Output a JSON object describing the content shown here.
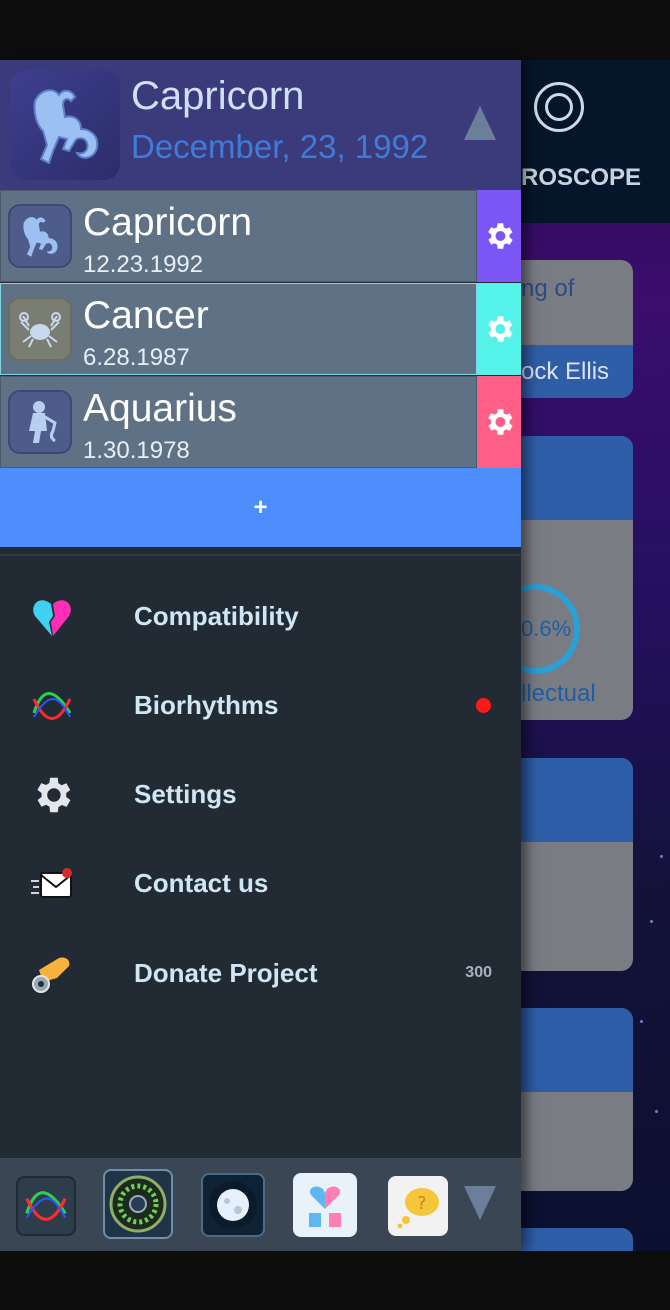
{
  "background_app": {
    "header_title_fragment": "ROSCOPE",
    "card1_text_a": "ng of",
    "card1_text_b": "ock Ellis",
    "gauge_value": "0.6%",
    "gauge_label": "llectual"
  },
  "drawer": {
    "current_profile": {
      "name": "Capricorn",
      "date": "December, 23, 1992",
      "icon": "capricorn-icon"
    },
    "profiles": [
      {
        "name": "Capricorn",
        "date": "12.23.1992",
        "icon": "capricorn-icon",
        "color": "#7c56f5"
      },
      {
        "name": "Cancer",
        "date": "6.28.1987",
        "icon": "cancer-icon",
        "color": "#54f2e8"
      },
      {
        "name": "Aquarius",
        "date": "1.30.1978",
        "icon": "aquarius-icon",
        "color": "#ff5f86"
      }
    ],
    "add_button_label": "+",
    "menu": [
      {
        "label": "Compatibility",
        "icon": "heart-icon"
      },
      {
        "label": "Biorhythms",
        "icon": "biorhythm-icon",
        "has_notification": true
      },
      {
        "label": "Settings",
        "icon": "gear-icon"
      },
      {
        "label": "Contact us",
        "icon": "mail-icon"
      },
      {
        "label": "Donate Project",
        "icon": "donate-icon",
        "count": "300"
      }
    ],
    "bottom_apps": [
      "biorhythm-app-icon",
      "zodiac-wheel-app-icon",
      "moon-app-icon",
      "compatibility-app-icon",
      "question-app-icon"
    ]
  },
  "colors": {
    "accent_blue": "#4d8dfc",
    "header_purple": "#3b3a7a",
    "drawer_bg": "#222a33"
  }
}
